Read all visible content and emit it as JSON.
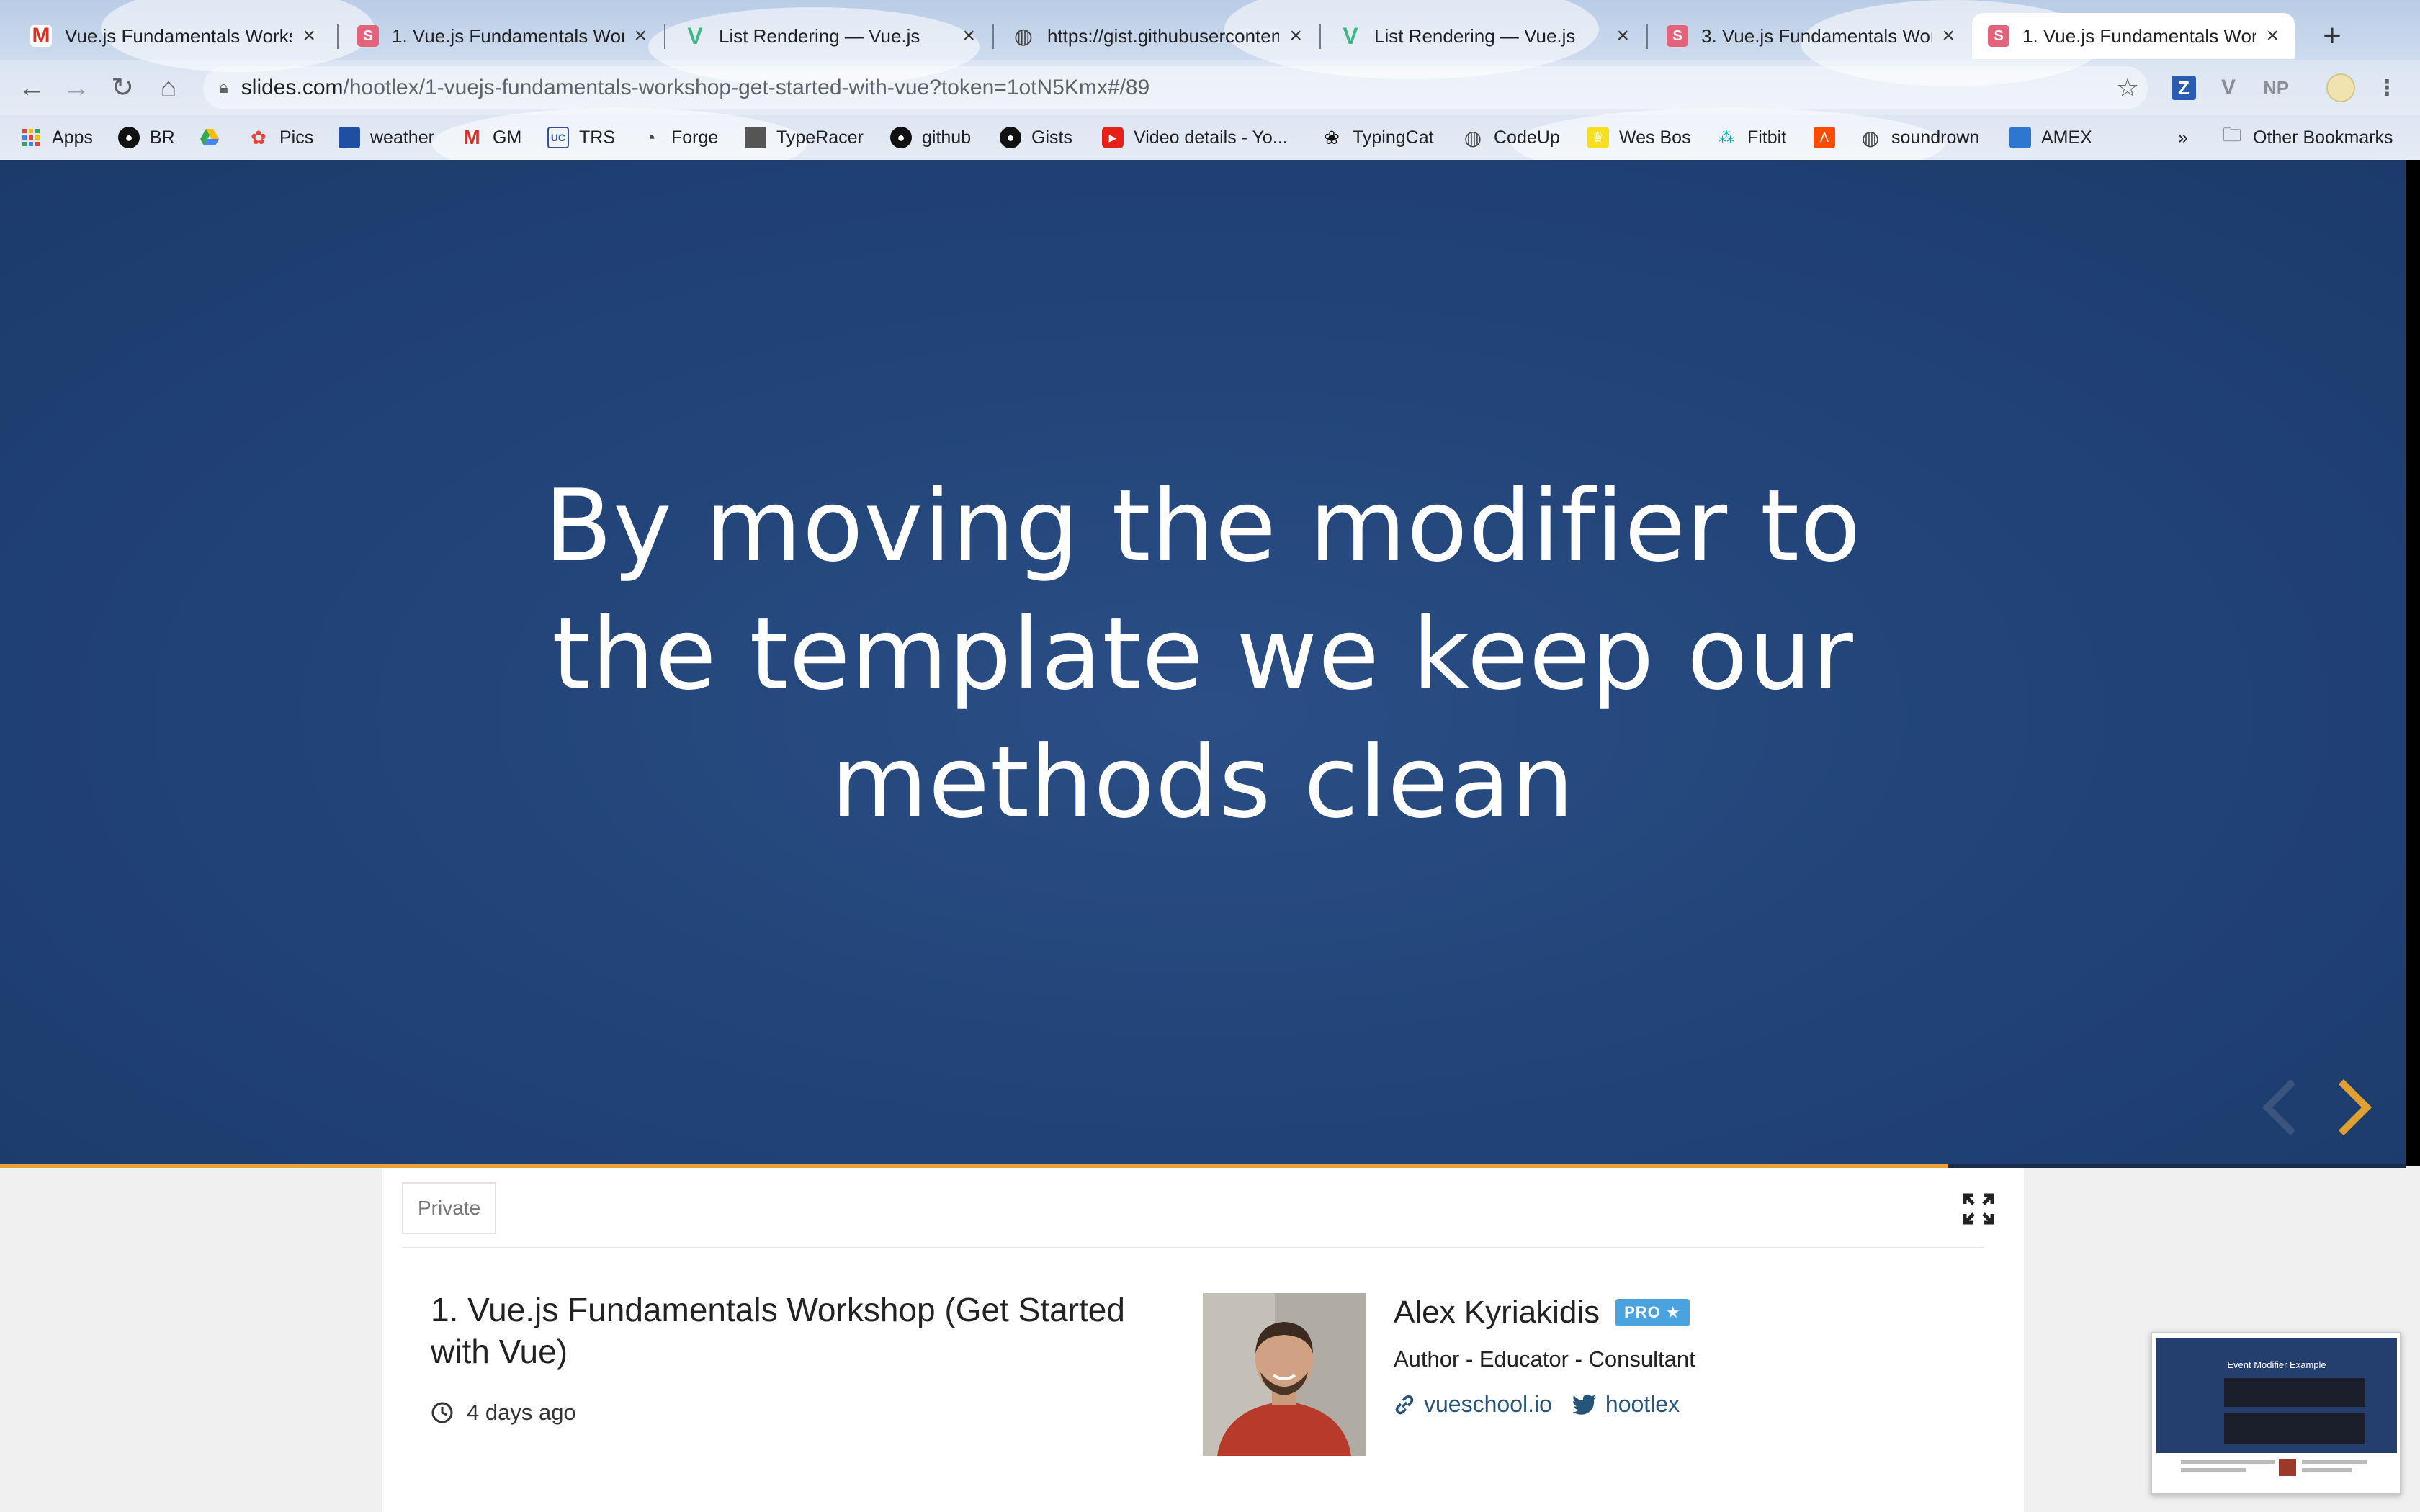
{
  "browser": {
    "tabs": [
      {
        "title": "Vue.js Fundamentals Worksh",
        "favicon": "gmail-icon",
        "active": false
      },
      {
        "title": "1. Vue.js Fundamentals Work",
        "favicon": "slides-icon",
        "active": false
      },
      {
        "title": "List Rendering — Vue.js",
        "favicon": "vue-icon",
        "active": false
      },
      {
        "title": "https://gist.githubuserconten",
        "favicon": "globe-icon",
        "active": false
      },
      {
        "title": "List Rendering — Vue.js",
        "favicon": "vue-icon",
        "active": false
      },
      {
        "title": "3. Vue.js Fundamentals Work",
        "favicon": "slides-icon",
        "active": false
      },
      {
        "title": "1. Vue.js Fundamentals Work",
        "favicon": "slides-icon",
        "active": true
      }
    ],
    "address": {
      "host": "slides.com",
      "path": "/hootlex/1-vuejs-fundamentals-workshop-get-started-with-vue?token=1otN5Kmx#/89"
    },
    "extensions": [
      "Z",
      "V",
      "NP"
    ],
    "bookmarks": [
      {
        "label": "Apps",
        "icon": "apps-grid-icon"
      },
      {
        "label": "BR",
        "icon": "github-icon"
      },
      {
        "label": "",
        "icon": "google-drive-icon"
      },
      {
        "label": "Pics",
        "icon": "google-photos-icon"
      },
      {
        "label": "weather",
        "icon": "weather-icon"
      },
      {
        "label": "GM",
        "icon": "gmail-icon"
      },
      {
        "label": "TRS",
        "icon": "trs-icon"
      },
      {
        "label": "Forge",
        "icon": "forge-icon"
      },
      {
        "label": "TypeRacer",
        "icon": "typeracer-icon"
      },
      {
        "label": "github",
        "icon": "github-icon"
      },
      {
        "label": "Gists",
        "icon": "github-icon"
      },
      {
        "label": "Video details - Yo...",
        "icon": "youtube-icon"
      },
      {
        "label": "TypingCat",
        "icon": "paw-icon"
      },
      {
        "label": "CodeUp",
        "icon": "globe-icon"
      },
      {
        "label": "Wes Bos",
        "icon": "crown-icon"
      },
      {
        "label": "Fitbit",
        "icon": "fitbit-icon"
      },
      {
        "label": "",
        "icon": "strava-icon"
      },
      {
        "label": "soundrown",
        "icon": "globe-icon"
      },
      {
        "label": "AMEX",
        "icon": "amex-icon"
      }
    ],
    "bookmarks_overflow": "»",
    "other_bookmarks": "Other Bookmarks"
  },
  "slide": {
    "lines": [
      "By moving the modifier to",
      "the template we keep our",
      "methods clean"
    ],
    "progress": 0.81,
    "colors": {
      "background": "#224478",
      "accent": "#e8a23a"
    }
  },
  "deck": {
    "visibility": "Private",
    "title": "1. Vue.js Fundamentals Workshop (Get Started with Vue)",
    "time": "4 days ago"
  },
  "author": {
    "name": "Alex Kyriakidis",
    "badge": "PRO ★",
    "role": "Author - Educator - Consultant",
    "website": "vueschool.io",
    "twitter": "hootlex"
  },
  "preview": {
    "title": "Event Modifier Example"
  }
}
